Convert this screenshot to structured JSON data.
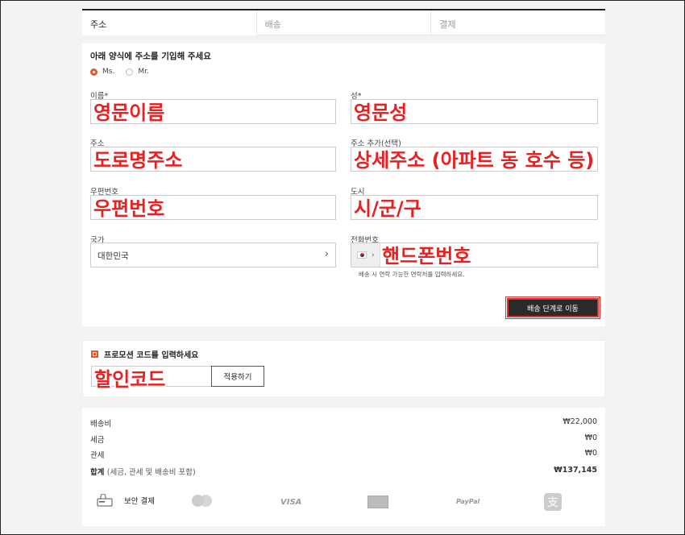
{
  "tabs": [
    {
      "label": "주소",
      "active": true
    },
    {
      "label": "배송",
      "active": false
    },
    {
      "label": "결제",
      "active": false
    }
  ],
  "address_form": {
    "title": "아래 양식에 주소를 기입해 주세요",
    "salutations": [
      {
        "label": "Ms.",
        "selected": true
      },
      {
        "label": "Mr.",
        "selected": false
      }
    ],
    "fields": {
      "first_name": {
        "label": "이름*",
        "overlay": "영문이름"
      },
      "last_name": {
        "label": "성*",
        "overlay": "영문성"
      },
      "address": {
        "label": "주소",
        "overlay": "도로명주소"
      },
      "address2": {
        "label": "주소 추가(선택)",
        "overlay": "상세주소 (아파트 동 호수 등)"
      },
      "postal": {
        "label": "우편번호",
        "overlay": "우편번호"
      },
      "city": {
        "label": "도시",
        "overlay": "시/군/구"
      },
      "country": {
        "label": "국가",
        "value": "대한민국",
        "chevron": "›"
      },
      "phone": {
        "label": "전화번호",
        "overlay": "핸드폰번호",
        "hint": "배송 시 연락 가능한 연락처를 입력하세요."
      }
    },
    "next_button": "배송 단계로 이동"
  },
  "promo": {
    "title": "프로모션 코드를 입력하세요",
    "overlay": "할인코드",
    "apply_button": "적용하기"
  },
  "summary": {
    "rows": [
      {
        "label": "배송비",
        "value": "₩22,000"
      },
      {
        "label": "세금",
        "value": "₩0"
      },
      {
        "label": "관세",
        "value": "₩0"
      }
    ],
    "total_label": "합계",
    "total_sub": "(세금, 관세 및 배송비 포함)",
    "total_value": "₩137,145",
    "secure_label": "보안 결제",
    "payment_methods": [
      "VISA",
      "PayPal"
    ]
  },
  "colors": {
    "accent": "#e05a2a",
    "annotation": "#ea1f1f",
    "button": "#2a2a2a"
  }
}
